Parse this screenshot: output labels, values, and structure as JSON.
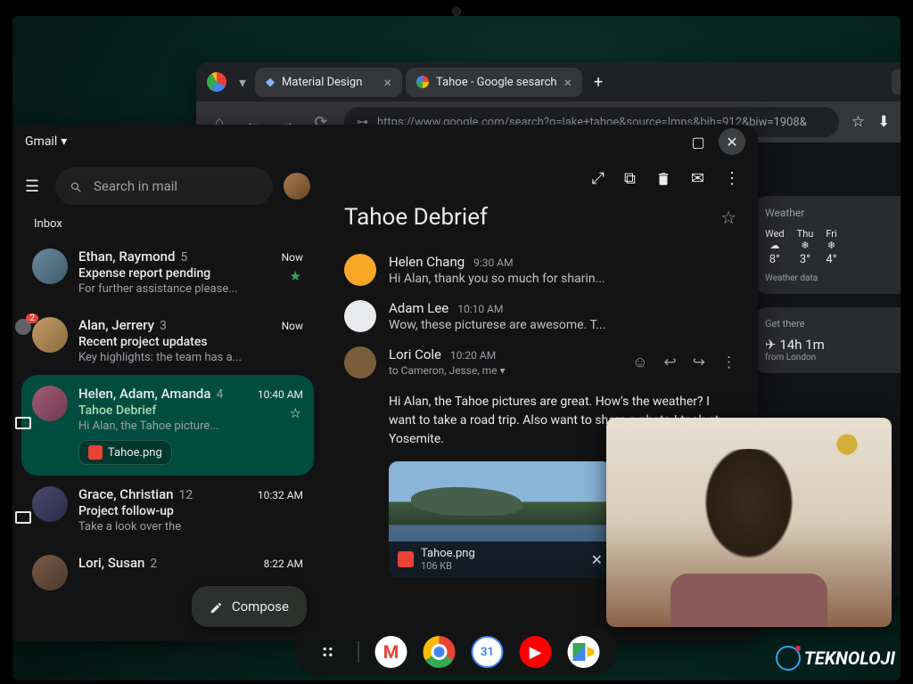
{
  "watermark": {
    "text": "TEKNOLOJI"
  },
  "chrome": {
    "tabs": [
      {
        "label": "Material Design",
        "icon": "material"
      },
      {
        "label": "Tahoe - Google sesarch",
        "icon": "google"
      }
    ],
    "url": "https://www.google.com/search?q=lake+tahoe&source=lmns&bih=912&biw=1908&"
  },
  "weather": {
    "title": "Weather",
    "days": [
      {
        "day": "Wed",
        "temp": "8°",
        "icon": "☁"
      },
      {
        "day": "Thu",
        "temp": "3°",
        "icon": "❄"
      },
      {
        "day": "Fri",
        "temp": "4°",
        "icon": "❄"
      }
    ],
    "note": "Weather data"
  },
  "travel": {
    "label": "Get there",
    "duration": "14h 1m",
    "from": "from London",
    "icon": "✈"
  },
  "gmail": {
    "title": "Gmail",
    "search_placeholder": "Search in mail",
    "folder": "Inbox",
    "compose": "Compose",
    "badge": "2",
    "threads": [
      {
        "senders": "Ethan, Raymond",
        "count": "5",
        "time": "Now",
        "subject": "Expense report pending",
        "preview": "For further assistance please...",
        "starred": true
      },
      {
        "senders": "Alan, Jerrery",
        "count": "3",
        "time": "Now",
        "subject": "Recent project updates",
        "preview": "Key highlights: the team has a...",
        "starred": false
      },
      {
        "senders": "Helen, Adam, Amanda",
        "count": "4",
        "time": "10:40 AM",
        "subject": "Tahoe Debrief",
        "preview": "Hi Alan, the Tahoe picture...",
        "starred": true,
        "selected": true,
        "attachment": "Tahoe.png"
      },
      {
        "senders": "Grace, Christian",
        "count": "12",
        "time": "10:32 AM",
        "subject": "Project follow-up",
        "preview": "Take a look over the",
        "starred": false
      },
      {
        "senders": "Lori, Susan",
        "count": "2",
        "time": "8:22 AM",
        "subject": "",
        "preview": "",
        "starred": false
      }
    ],
    "reading": {
      "title": "Tahoe Debrief",
      "messages": [
        {
          "sender": "Helen Chang",
          "time": "9:30 AM",
          "preview": "Hi Alan, thank you so much for sharin...",
          "avatar": "#f9a825"
        },
        {
          "sender": "Adam Lee",
          "time": "10:10 AM",
          "preview": "Wow, these picturese are awesome. T...",
          "avatar": "#e8eaed"
        },
        {
          "sender": "Lori Cole",
          "time": "10:20 AM",
          "to": "to Cameron, Jesse, me",
          "avatar": "#7b5e3b",
          "expanded": true
        }
      ],
      "body": "Hi Alan, the Tahoe pictures are great. How's the weather? I want to take a road trip. Also want to share a photo I took at Yosemite.",
      "attachment": {
        "name": "Tahoe.png",
        "size": "106 KB"
      }
    }
  },
  "taskbar": {
    "apps": [
      "gmail",
      "chrome",
      "calendar",
      "youtube",
      "meet"
    ]
  }
}
